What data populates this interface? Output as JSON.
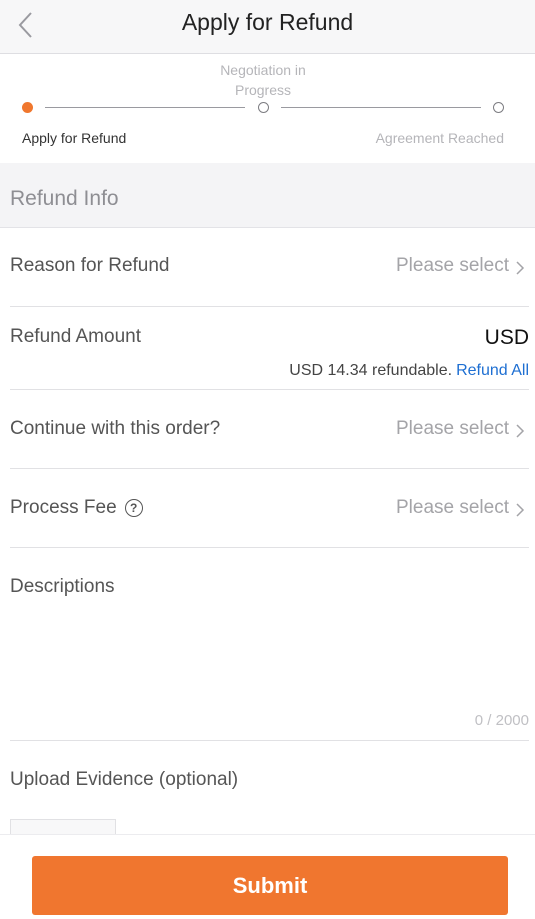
{
  "header": {
    "title": "Apply for Refund",
    "back_icon": "chevron-left-icon"
  },
  "steps": [
    {
      "label": "Apply for Refund",
      "state": "active"
    },
    {
      "label": "Negotiation in Progress",
      "state": "pending"
    },
    {
      "label": "Agreement Reached",
      "state": "pending"
    }
  ],
  "section": {
    "title": "Refund Info"
  },
  "form": {
    "reason": {
      "label": "Reason for Refund",
      "value": "Please select"
    },
    "amount": {
      "label": "Refund Amount",
      "currency": "USD",
      "refundable_text": "USD 14.34 refundable.",
      "refund_all": "Refund All"
    },
    "continue_order": {
      "label": "Continue with this order?",
      "value": "Please select"
    },
    "process_fee": {
      "label": "Process Fee",
      "help_icon": "?",
      "value": "Please select"
    },
    "descriptions": {
      "label": "Descriptions",
      "counter": "0 / 2000"
    },
    "upload": {
      "label": "Upload Evidence (optional)"
    }
  },
  "footer": {
    "submit_label": "Submit"
  },
  "colors": {
    "accent": "#f0772e",
    "link": "#1e6fd2"
  }
}
